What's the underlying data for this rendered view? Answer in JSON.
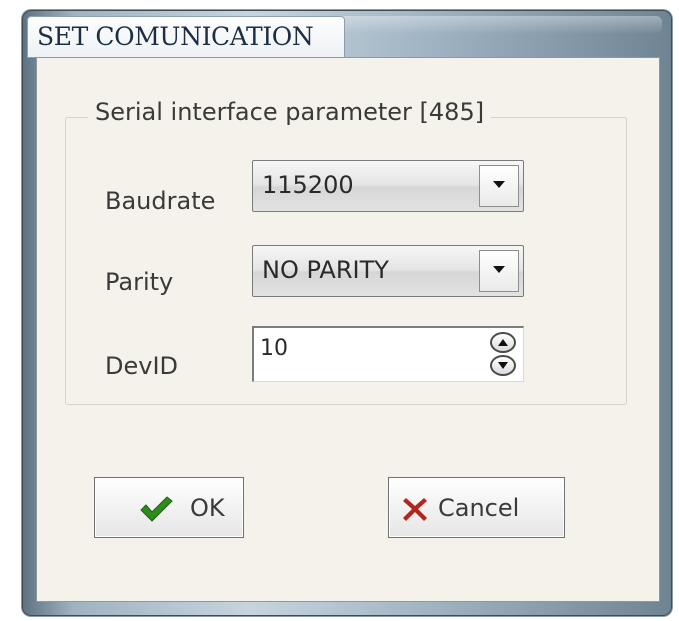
{
  "window": {
    "title": "SET COMUNICATION"
  },
  "group": {
    "title": "Serial interface parameter [485]"
  },
  "fields": {
    "baudrate": {
      "label": "Baudrate",
      "value": "115200"
    },
    "parity": {
      "label": "Parity",
      "value": "NO PARITY"
    },
    "devid": {
      "label": "DevID",
      "value": "10"
    }
  },
  "buttons": {
    "ok": {
      "label": "OK",
      "icon": "checkmark-icon",
      "icon_color": "#2e8b1e"
    },
    "cancel": {
      "label": "Cancel",
      "icon": "x-icon",
      "icon_color": "#b3261e"
    }
  }
}
